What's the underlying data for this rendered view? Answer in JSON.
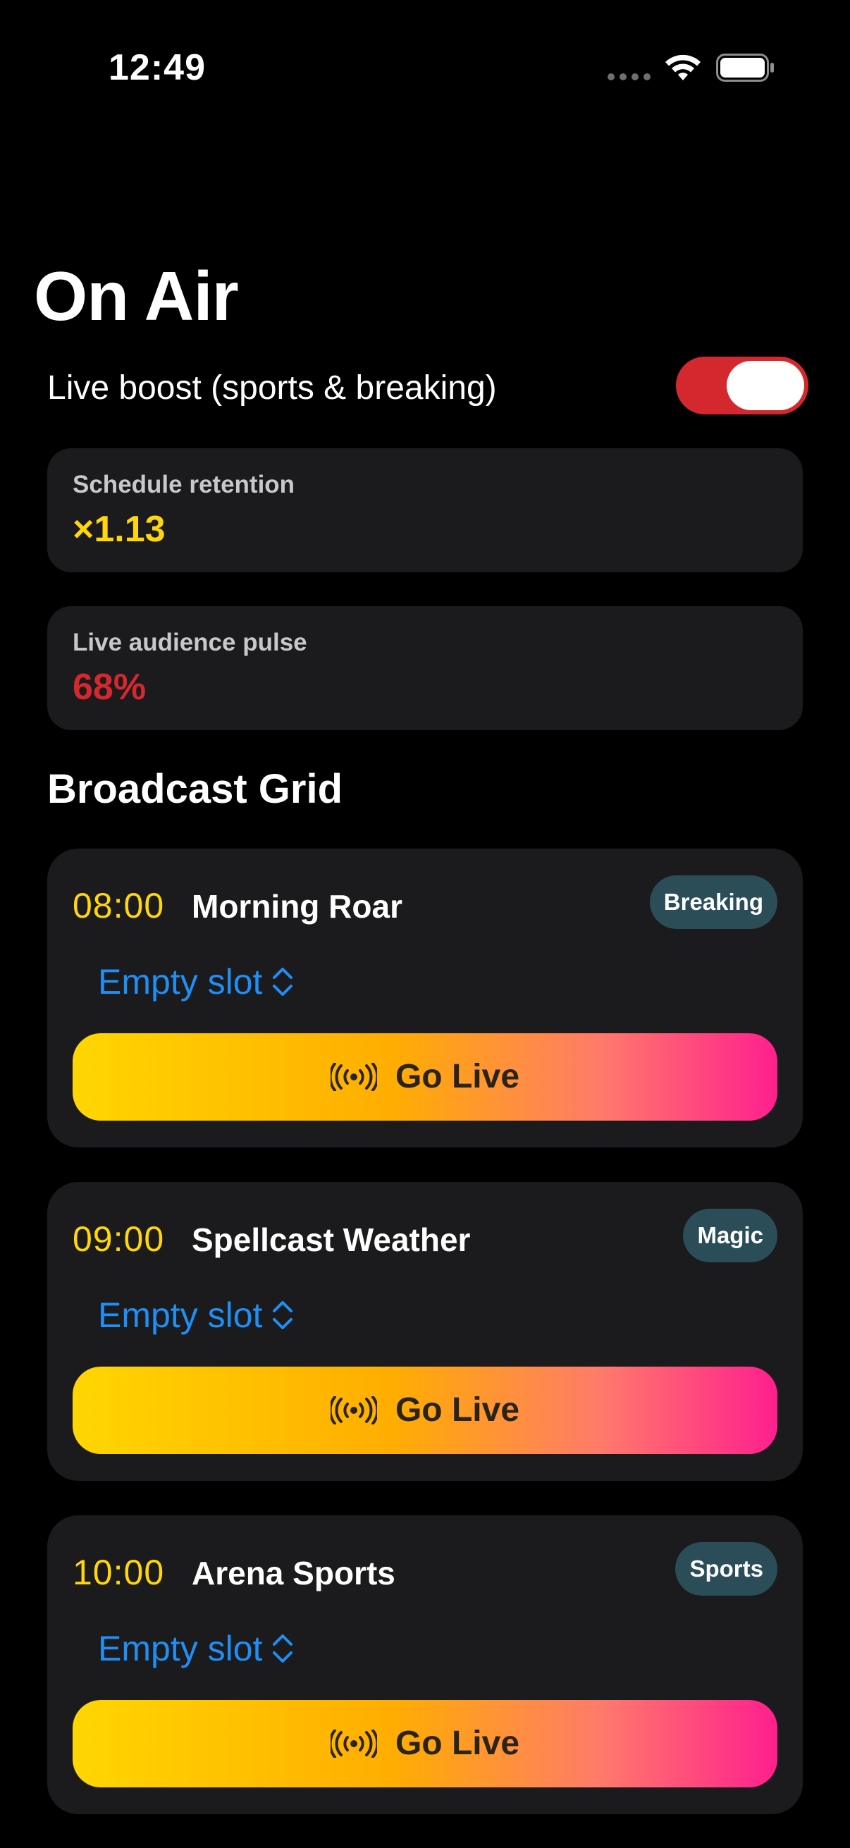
{
  "status_bar": {
    "time": "12:49",
    "signal_icon": "cellular-dots-icon",
    "wifi_icon": "wifi-icon",
    "battery_icon": "battery-icon"
  },
  "header": {
    "title": "On Air"
  },
  "live_boost": {
    "label": "Live boost (sports & breaking)",
    "enabled": true,
    "toggle_color": "#d4282f"
  },
  "stats": {
    "retention": {
      "label": "Schedule retention",
      "value": "×1.13",
      "color": "#ffd60a"
    },
    "pulse": {
      "label": "Live audience pulse",
      "value": "68%",
      "color": "#d4282f"
    }
  },
  "grid": {
    "title": "Broadcast Grid",
    "slots": [
      {
        "time": "08:00",
        "show": "Morning Roar",
        "tag": "Breaking",
        "picker": "Empty slot",
        "action": "Go Live"
      },
      {
        "time": "09:00",
        "show": "Spellcast Weather",
        "tag": "Magic",
        "picker": "Empty slot",
        "action": "Go Live"
      },
      {
        "time": "10:00",
        "show": "Arena Sports",
        "tag": "Sports",
        "picker": "Empty slot",
        "action": "Go Live"
      }
    ]
  },
  "colors": {
    "time_accent": "#ffd60a",
    "picker_accent": "#1f8ff5",
    "tag_background": "#2a4d58",
    "card_background": "#1b1b1d",
    "gradient": [
      "#ffd600",
      "#ffae00",
      "#ff7a6a",
      "#ff1f8e"
    ]
  }
}
